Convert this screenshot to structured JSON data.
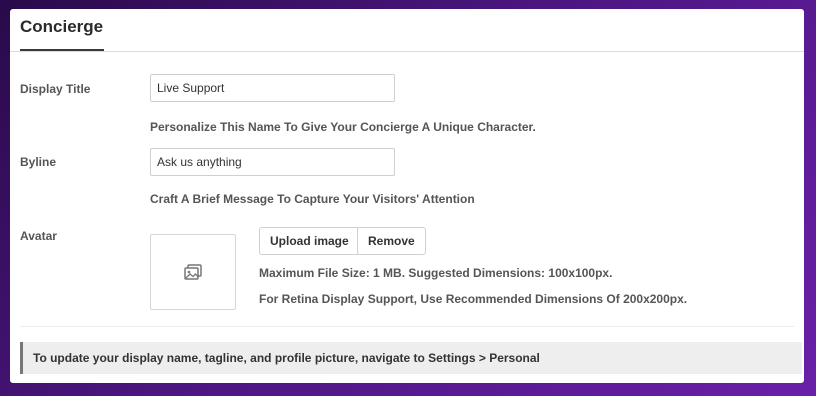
{
  "tab": {
    "title": "Concierge"
  },
  "display_title": {
    "label": "Display Title",
    "value": "Live Support",
    "hint": "Personalize This Name To Give Your Concierge A Unique Character."
  },
  "byline": {
    "label": "Byline",
    "value": "Ask us anything",
    "hint": "Craft A Brief Message To Capture Your Visitors' Attention"
  },
  "avatar": {
    "label": "Avatar",
    "upload_label": "Upload image",
    "remove_label": "Remove",
    "max_size_text": "Maximum File Size: 1 MB. Suggested Dimensions: 100x100px.",
    "retina_text": "For Retina Display Support, Use Recommended Dimensions Of 200x200px.",
    "placeholder_icon": "image-placeholder-icon"
  },
  "notice": {
    "text": "To update your display name, tagline, and profile picture, navigate to Settings > Personal"
  },
  "colors": {
    "background_gradient": [
      "#2a0a4a",
      "#6a1fa8"
    ],
    "panel": "#ffffff",
    "notice_bg": "#eeeeee"
  }
}
